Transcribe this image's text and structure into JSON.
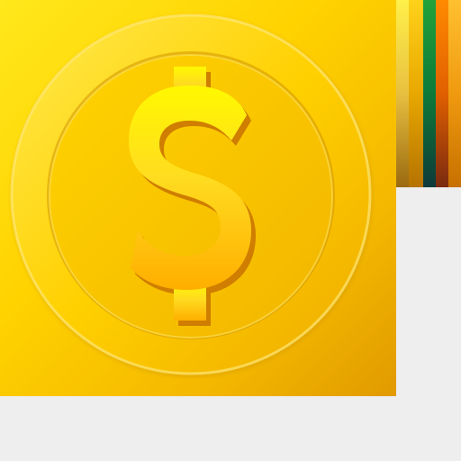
{
  "icon": {
    "name": "dollar-coin-icon",
    "symbol": "dollar-sign",
    "colors": {
      "tile_top": "#ffe81c",
      "tile_bottom": "#e19a00",
      "ring_light": "#ffe566",
      "ring_shadow": "#c98f00",
      "symbol_top": "#fff600",
      "symbol_bottom": "#ffb000",
      "symbol_edge": "#d17d00"
    }
  },
  "swatches": [
    {
      "name": "swatch-pale-yellow",
      "top": "#fff04a",
      "bottom": "#9a6a10"
    },
    {
      "name": "swatch-gold",
      "top": "#ffd21a",
      "bottom": "#b57300"
    },
    {
      "name": "swatch-green",
      "top": "#1b8a2a",
      "bottom": "#0f4a2a"
    },
    {
      "name": "swatch-orange",
      "top": "#ff7a00",
      "bottom": "#8a3a10"
    },
    {
      "name": "swatch-amber",
      "top": "#ffb020",
      "bottom": "#c77000"
    }
  ]
}
